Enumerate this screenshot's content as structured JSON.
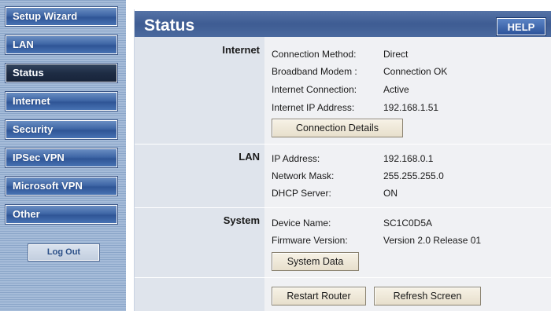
{
  "sidebar": {
    "items": [
      {
        "label": "Setup Wizard"
      },
      {
        "label": "LAN"
      },
      {
        "label": "Status"
      },
      {
        "label": "Internet"
      },
      {
        "label": "Security"
      },
      {
        "label": "IPSec VPN"
      },
      {
        "label": "Microsoft VPN"
      },
      {
        "label": "Other"
      }
    ],
    "active": "Status",
    "logout_label": "Log Out"
  },
  "header": {
    "title": "Status",
    "help_label": "HELP"
  },
  "internet": {
    "label": "Internet",
    "rows": [
      {
        "key": "Connection Method:",
        "value": "Direct"
      },
      {
        "key": "Broadband Modem :",
        "value": "Connection OK"
      },
      {
        "key": "Internet Connection:",
        "value": "Active"
      },
      {
        "key": "Internet IP Address:",
        "value": "192.168.1.51"
      }
    ],
    "button_label": "Connection Details"
  },
  "lan": {
    "label": "LAN",
    "rows": [
      {
        "key": "IP Address:",
        "value": "192.168.0.1"
      },
      {
        "key": "Network Mask:",
        "value": "255.255.255.0"
      },
      {
        "key": "DHCP Server:",
        "value": "ON"
      }
    ]
  },
  "system": {
    "label": "System",
    "rows": [
      {
        "key": "Device Name:",
        "value": "SC1C0D5A"
      },
      {
        "key": "Firmware Version:",
        "value": "Version 2.0 Release 01"
      }
    ],
    "button_label": "System Data"
  },
  "footer": {
    "restart_label": "Restart Router",
    "refresh_label": "Refresh Screen"
  },
  "colors": {
    "title_bar": "#3e5c93",
    "active_nav": "#1e2c44",
    "nav": "#3f67a6"
  }
}
